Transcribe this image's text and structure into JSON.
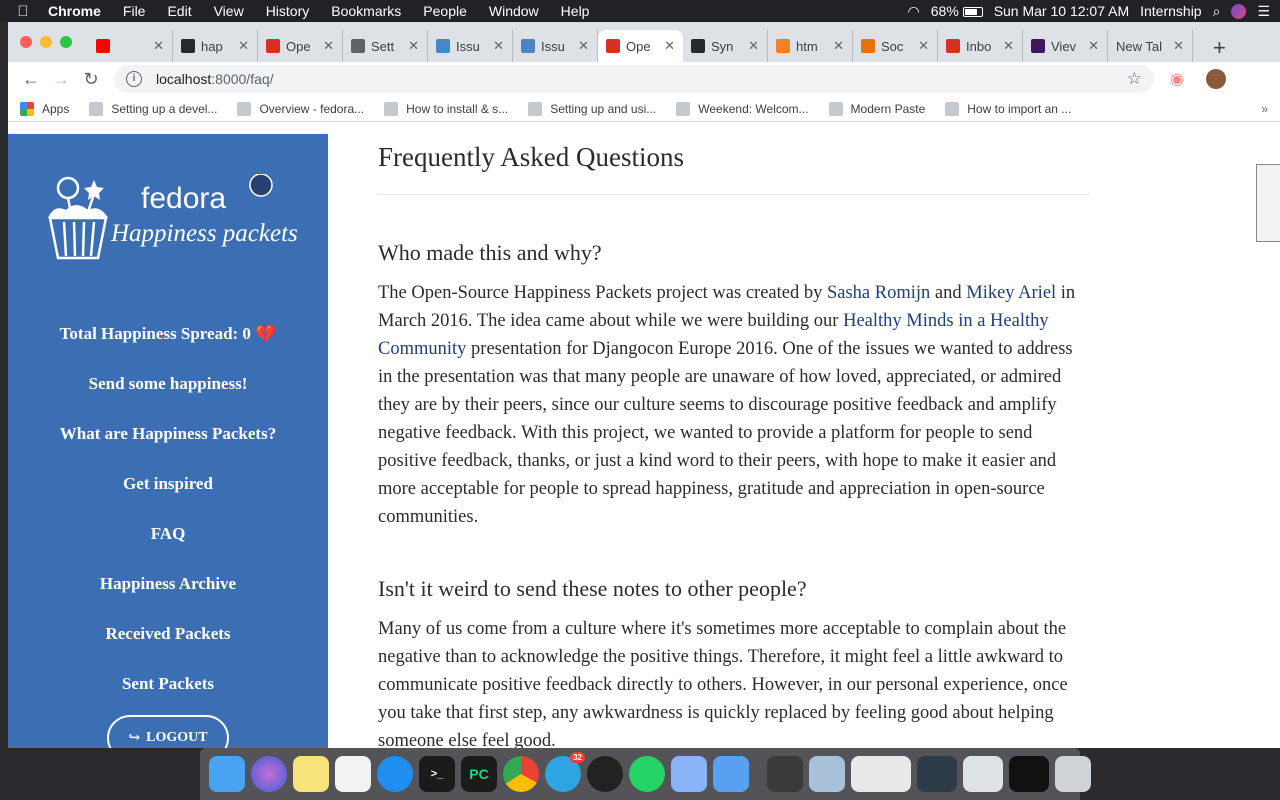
{
  "menubar": {
    "app": "Chrome",
    "items": [
      "File",
      "Edit",
      "View",
      "History",
      "Bookmarks",
      "People",
      "Window",
      "Help"
    ],
    "battery": "68%",
    "datetime": "Sun Mar 10  12:07 AM",
    "user": "Internship"
  },
  "tabs": [
    {
      "label": "",
      "icon": "youtube-icon",
      "color": "#ff0000"
    },
    {
      "label": "hap",
      "icon": "github-icon",
      "color": "#24292e"
    },
    {
      "label": "Ope",
      "icon": "gmail-icon",
      "color": "#d93025"
    },
    {
      "label": "Sett",
      "icon": "settings-page-icon",
      "color": "#5f6368"
    },
    {
      "label": "Issu",
      "icon": "pagure-icon",
      "color": "#4a86c5"
    },
    {
      "label": "Issu",
      "icon": "pagure-icon",
      "color": "#4a86c5"
    },
    {
      "label": "Ope",
      "icon": "gmail-icon",
      "color": "#d93025",
      "active": true
    },
    {
      "label": "Syn",
      "icon": "github-icon",
      "color": "#24292e"
    },
    {
      "label": "htm",
      "icon": "stackoverflow-icon",
      "color": "#f48024"
    },
    {
      "label": "Soc",
      "icon": "social-icon",
      "color": "#e8710a"
    },
    {
      "label": "Inbo",
      "icon": "gmail-icon",
      "color": "#d93025"
    },
    {
      "label": "Viev",
      "icon": "premier-league-icon",
      "color": "#3d195b"
    },
    {
      "label": "New Tal",
      "icon": "",
      "color": ""
    }
  ],
  "toolbar": {
    "url_host": "localhost",
    "url_path": ":8000/faq/"
  },
  "bookmarks": [
    {
      "label": "Apps",
      "icon": "apps-grid-icon"
    },
    {
      "label": "Setting up a devel...",
      "icon": "doc-icon"
    },
    {
      "label": "Overview - fedora...",
      "icon": "pagure-icon"
    },
    {
      "label": "How to install & s...",
      "icon": "medium-icon"
    },
    {
      "label": "Setting up and usi...",
      "icon": "github-icon"
    },
    {
      "label": "Weekend: Welcom...",
      "icon": "flower-icon"
    },
    {
      "label": "Modern Paste",
      "icon": "file-icon"
    },
    {
      "label": "How to import an ...",
      "icon": "stackoverflow-icon"
    }
  ],
  "sidebar": {
    "logo_text_1": "fedora",
    "logo_text_2": "Happiness packets",
    "total_label": "Total Happiness Spread: 0 💔",
    "links": [
      "Send some happiness!",
      "What are Happiness Packets?",
      "Get inspired",
      "FAQ",
      "Happiness Archive",
      "Received Packets",
      "Sent Packets"
    ],
    "logout": "LOGOUT"
  },
  "content": {
    "title": "Frequently Asked Questions",
    "q1": {
      "question": "Who made this and why?",
      "p_a": "The Open-Source Happiness Packets project was created by ",
      "link1": "Sasha Romijn",
      "p_b": " and ",
      "link2": "Mikey Ariel",
      "p_c": " in March 2016. The idea came about while we were building our ",
      "link3": "Healthy Minds in a Healthy Community",
      "p_d": " presentation for Djangocon Europe 2016. One of the issues we wanted to address in the presentation was that many people are unaware of how loved, appreciated, or admired they are by their peers, since our culture seems to discourage positive feedback and amplify negative feedback. With this project, we wanted to provide a platform for people to send positive feedback, thanks, or just a kind word to their peers, with hope to make it easier and more acceptable for people to spread happiness, gratitude and appreciation in open-source communities."
    },
    "q2": {
      "question": "Isn't it weird to send these notes to other people?",
      "answer": "Many of us come from a culture where it's sometimes more acceptable to complain about the negative than to acknowledge the positive things. Therefore, it might feel a little awkward to communicate positive feedback directly to others. However, in our personal experience, once you take that first step, any awkwardness is quickly replaced by feeling good about helping someone else feel good."
    }
  },
  "dock": {
    "telegram_badge": "32",
    "pycharm_label": "PC",
    "terminal_label": ">_"
  }
}
